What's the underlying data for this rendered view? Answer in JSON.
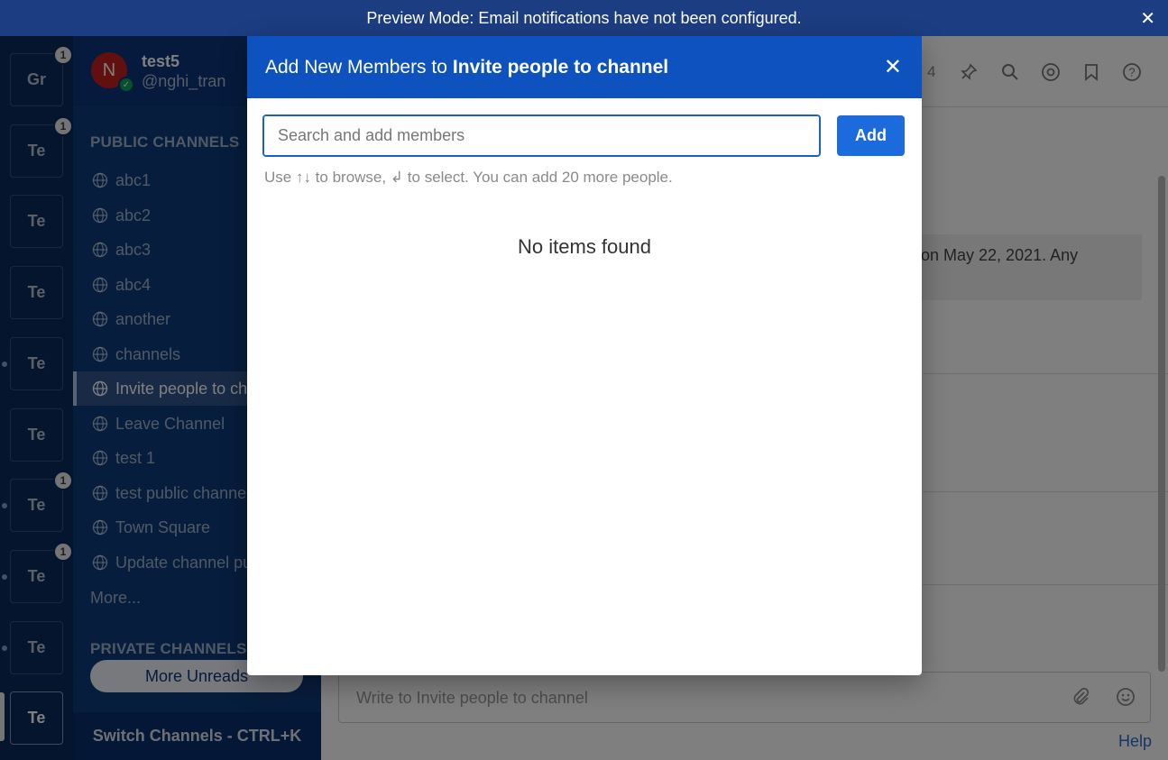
{
  "banner": {
    "text": "Preview Mode: Email notifications have not been configured.",
    "close_glyph": "✕"
  },
  "teams": [
    {
      "initials": "Gr",
      "badge": "1",
      "dot": false,
      "active": false
    },
    {
      "initials": "Te",
      "badge": "1",
      "dot": false,
      "active": false
    },
    {
      "initials": "Te",
      "badge": "",
      "dot": false,
      "active": false
    },
    {
      "initials": "Te",
      "badge": "",
      "dot": false,
      "active": false
    },
    {
      "initials": "Te",
      "badge": "",
      "dot": true,
      "active": false
    },
    {
      "initials": "Te",
      "badge": "",
      "dot": false,
      "active": false
    },
    {
      "initials": "Te",
      "badge": "1",
      "dot": true,
      "active": false
    },
    {
      "initials": "Te",
      "badge": "1",
      "dot": true,
      "active": false
    },
    {
      "initials": "Te",
      "badge": "",
      "dot": true,
      "active": false
    },
    {
      "initials": "Te",
      "badge": "",
      "dot": false,
      "active": true
    }
  ],
  "user": {
    "avatar_letter": "N",
    "name": "test5",
    "handle": "@nghi_tran",
    "status_glyph": "✓"
  },
  "sidebar": {
    "public_title": "PUBLIC CHANNELS",
    "public_channels": [
      {
        "label": "abc1",
        "active": false
      },
      {
        "label": "abc2",
        "active": false
      },
      {
        "label": "abc3",
        "active": false
      },
      {
        "label": "abc4",
        "active": false
      },
      {
        "label": "another",
        "active": false
      },
      {
        "label": "channels",
        "active": false
      },
      {
        "label": "Invite people to channel",
        "active": true
      },
      {
        "label": "Leave Channel",
        "active": false
      },
      {
        "label": "test 1",
        "active": false
      },
      {
        "label": "test public channel",
        "active": false
      },
      {
        "label": "Town Square",
        "active": false
      },
      {
        "label": "Update channel purpose",
        "active": false
      }
    ],
    "more_label": "More...",
    "private_title": "PRIVATE CHANNELS",
    "more_unreads_label": "More Unreads",
    "switch_label": "Switch Channels - CTRL+K"
  },
  "main": {
    "member_count": "4",
    "note_text": "on May 22, 2021. Any",
    "composer_placeholder": "Write to Invite people to channel",
    "help_label": "Help"
  },
  "modal": {
    "title_prefix": "Add New Members to",
    "title_channel": "Invite people to channel",
    "close_glyph": "✕",
    "search_placeholder": "Search and add members",
    "search_value": "",
    "add_label": "Add",
    "hint": "Use ↑↓ to browse, ↲ to select. You can add 20 more people.",
    "empty_text": "No items found"
  }
}
